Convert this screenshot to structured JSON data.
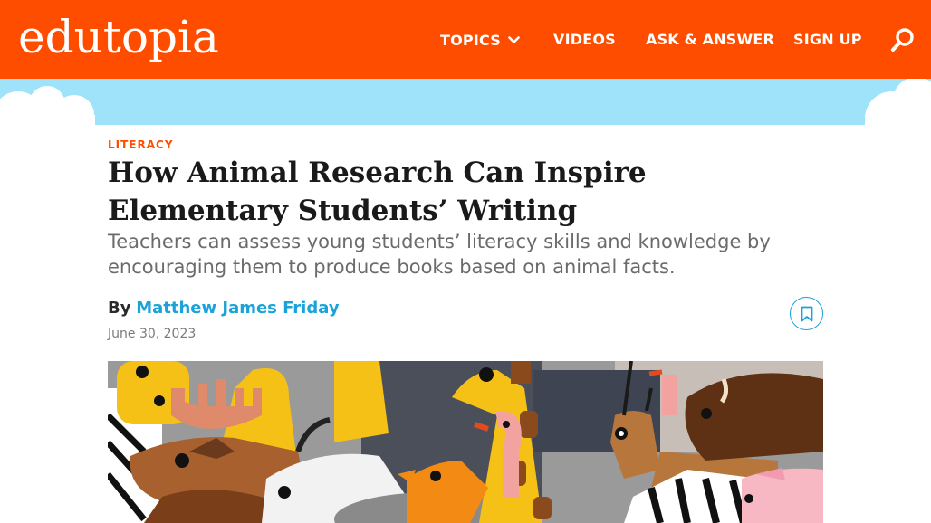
{
  "header": {
    "logo_text": "edutopia",
    "nav": {
      "topics": "TOPICS",
      "videos": "VIDEOS",
      "ask": "ASK & ANSWER",
      "signup": "SIGN UP"
    },
    "colors": {
      "brand": "#ff4d00",
      "sky": "#9ee3fa",
      "link": "#1aa3d9"
    }
  },
  "article": {
    "category": "LITERACY",
    "title": "How Animal Research Can Inspire Elementary Students’ Writing",
    "subtitle": "Teachers can assess young students’ literacy skills and knowledge by encouraging them to produce books based on animal facts.",
    "by_label": "By",
    "author": "Matthew James Friday",
    "date": "June 30, 2023"
  },
  "icons": {
    "search": "search-icon",
    "topics_chevron": "chevron-down-icon",
    "bookmark": "bookmark-icon"
  }
}
